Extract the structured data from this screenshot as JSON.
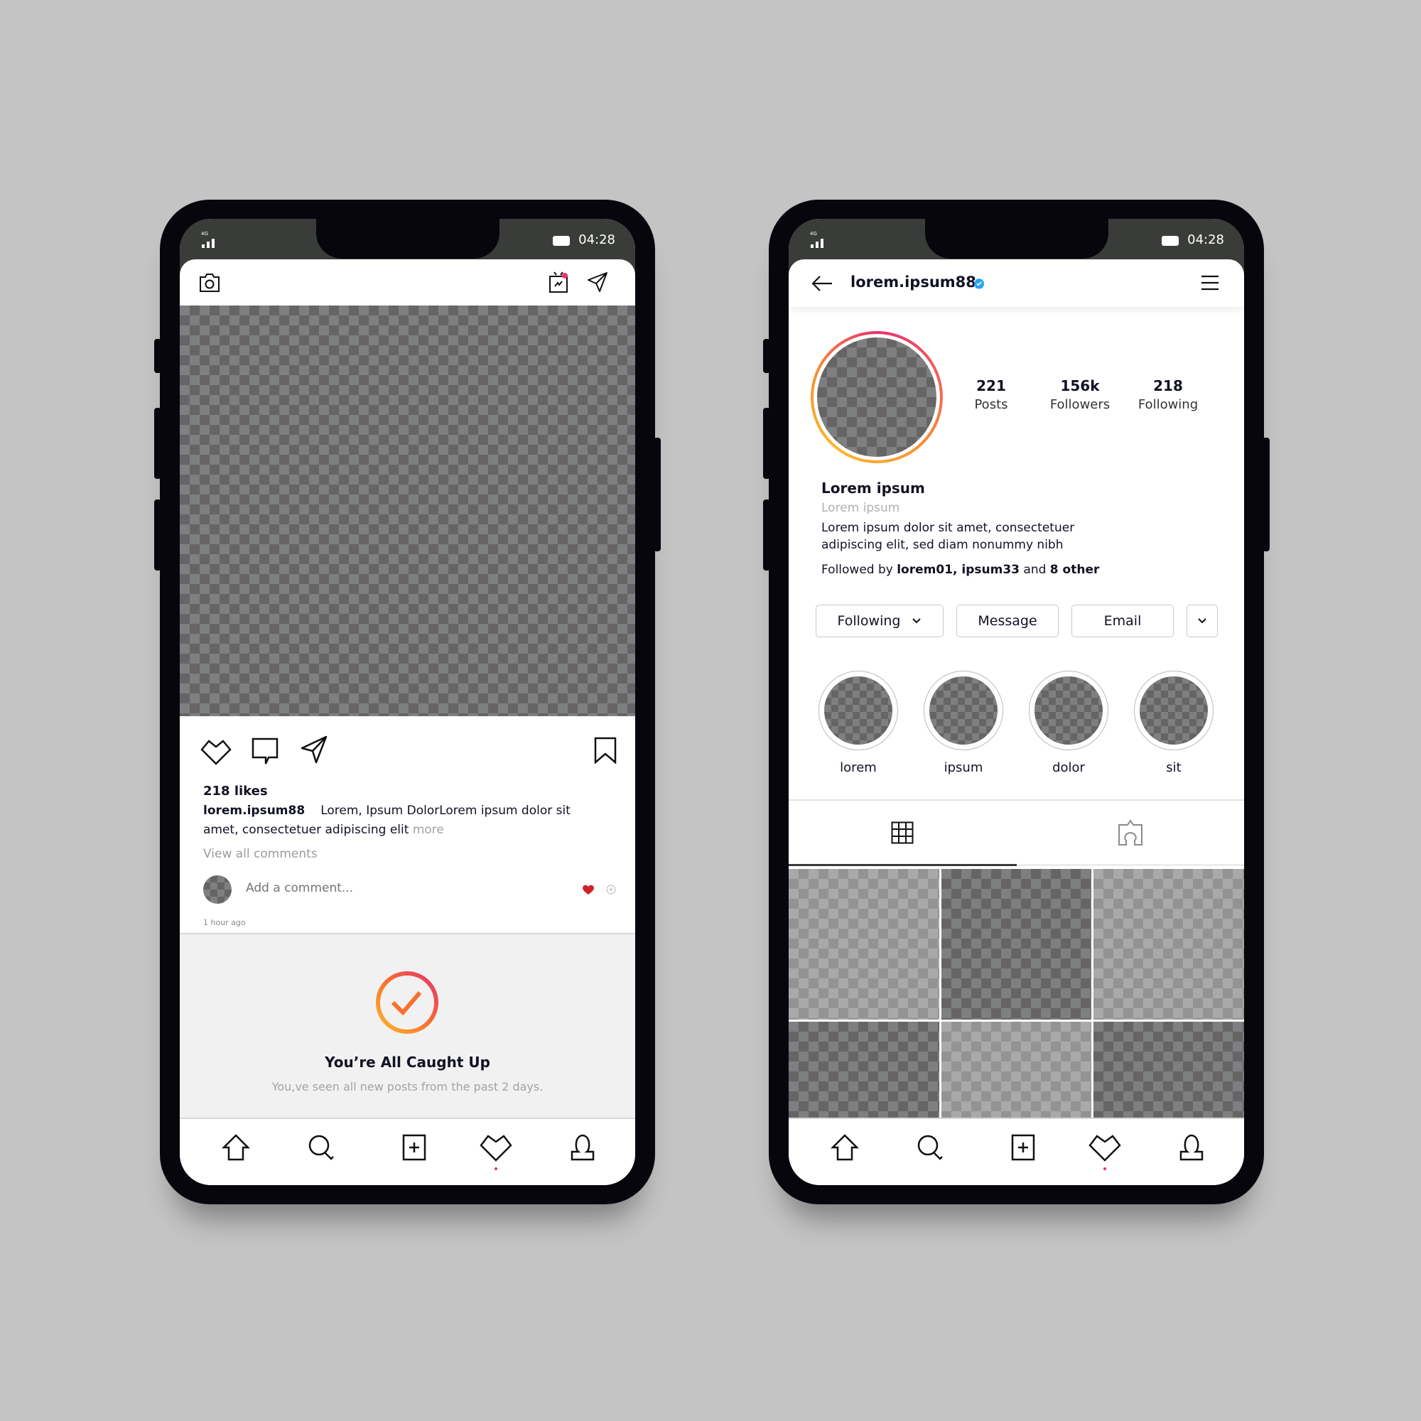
{
  "status_bar": {
    "network": "4G",
    "time": "04:28"
  },
  "feed": {
    "header": {
      "camera_icon": "camera-icon",
      "igtv_icon": "igtv-icon",
      "direct_icon": "paper-plane-icon"
    },
    "post": {
      "likes": "218 likes",
      "username": "lorem.ipsum88",
      "caption": "Lorem, Ipsum DolorLorem ipsum dolor sit amet, consectetuer adipiscing elit",
      "more_label": "more",
      "view_all_comments": "View all comments",
      "comment_placeholder": "Add a comment...",
      "time_ago": "1 hour ago"
    },
    "caught_up": {
      "title": "You’re All Caught Up",
      "subtitle": "You,ve seen all new posts from the past 2 days."
    }
  },
  "profile": {
    "username": "lorem.ipsum88",
    "verified": true,
    "stats": [
      {
        "value": "221",
        "label": "Posts"
      },
      {
        "value": "156k",
        "label": "Followers"
      },
      {
        "value": "218",
        "label": "Following"
      }
    ],
    "name": "Lorem ipsum",
    "category": "Lorem ipsum",
    "bio": "Lorem ipsum dolor sit amet, consectetuer adipiscing elit, sed diam nonummy nibh",
    "followed_by_prefix": "Followed by ",
    "followed_by_users": "lorem01, ipsum33",
    "followed_by_mid": " and ",
    "followed_by_count": "8 other",
    "buttons": {
      "following": "Following",
      "message": "Message",
      "email": "Email"
    },
    "highlights": [
      {
        "label": "lorem"
      },
      {
        "label": "ipsum"
      },
      {
        "label": "dolor"
      },
      {
        "label": "sit"
      }
    ],
    "tabs": [
      {
        "name": "grid",
        "icon": "grid-icon",
        "active": true
      },
      {
        "name": "tagged",
        "icon": "tagged-icon",
        "active": false
      }
    ],
    "grid_posts": 6
  },
  "bottom_nav": [
    {
      "name": "home",
      "icon": "home-icon"
    },
    {
      "name": "search",
      "icon": "search-icon"
    },
    {
      "name": "new-post",
      "icon": "add-post-icon"
    },
    {
      "name": "activity",
      "icon": "heart-icon",
      "active": true
    },
    {
      "name": "profile",
      "icon": "profile-icon"
    }
  ],
  "colors": {
    "accent_pink": "#e8336b",
    "accent_orange": "#f89432",
    "verified_blue": "#2aa3ef",
    "like_red": "#d0202a",
    "status_bar": "#3a3c39",
    "frame": "#07060c"
  }
}
